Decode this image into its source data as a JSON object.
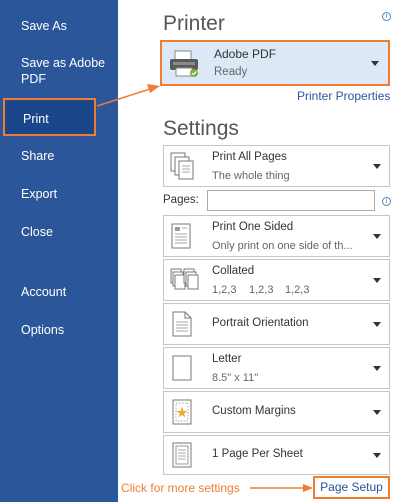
{
  "sidebar": {
    "items": [
      {
        "label": "Save As"
      },
      {
        "label": "Save as Adobe"
      },
      {
        "label": "PDF"
      },
      {
        "label": "Print"
      },
      {
        "label": "Share"
      },
      {
        "label": "Export"
      },
      {
        "label": "Close"
      },
      {
        "label": "Account"
      },
      {
        "label": "Options"
      }
    ]
  },
  "printer": {
    "title": "Printer",
    "name": "Adobe PDF",
    "status": "Ready",
    "properties_link": "Printer Properties"
  },
  "settings": {
    "title": "Settings",
    "print_range": {
      "main": "Print All Pages",
      "sub": "The whole thing"
    },
    "pages_label": "Pages:",
    "pages_value": "",
    "sides": {
      "main": "Print One Sided",
      "sub": "Only print on one side of th..."
    },
    "collation": {
      "main": "Collated",
      "sub": [
        "1,2,3",
        "1,2,3",
        "1,2,3"
      ]
    },
    "orientation": {
      "main": "Portrait Orientation"
    },
    "paper": {
      "main": "Letter",
      "sub": "8.5\" x 11\""
    },
    "margins": {
      "main": "Custom Margins"
    },
    "per_sheet": {
      "main": "1 Page Per Sheet"
    }
  },
  "footer": {
    "hint": "Click for more settings",
    "page_setup": "Page Setup"
  },
  "colors": {
    "sidebar_bg": "#2b579a",
    "active_bg": "#19478a",
    "highlight": "#ed7d31",
    "link": "#2b579a",
    "printer_box_bg": "#dce8f5"
  },
  "icons": [
    "printer-icon",
    "info-icon",
    "pages-icon",
    "one-sided-icon",
    "collated-icon",
    "portrait-icon",
    "letter-icon",
    "margins-icon",
    "per-sheet-icon",
    "dropdown-arrow-icon"
  ]
}
